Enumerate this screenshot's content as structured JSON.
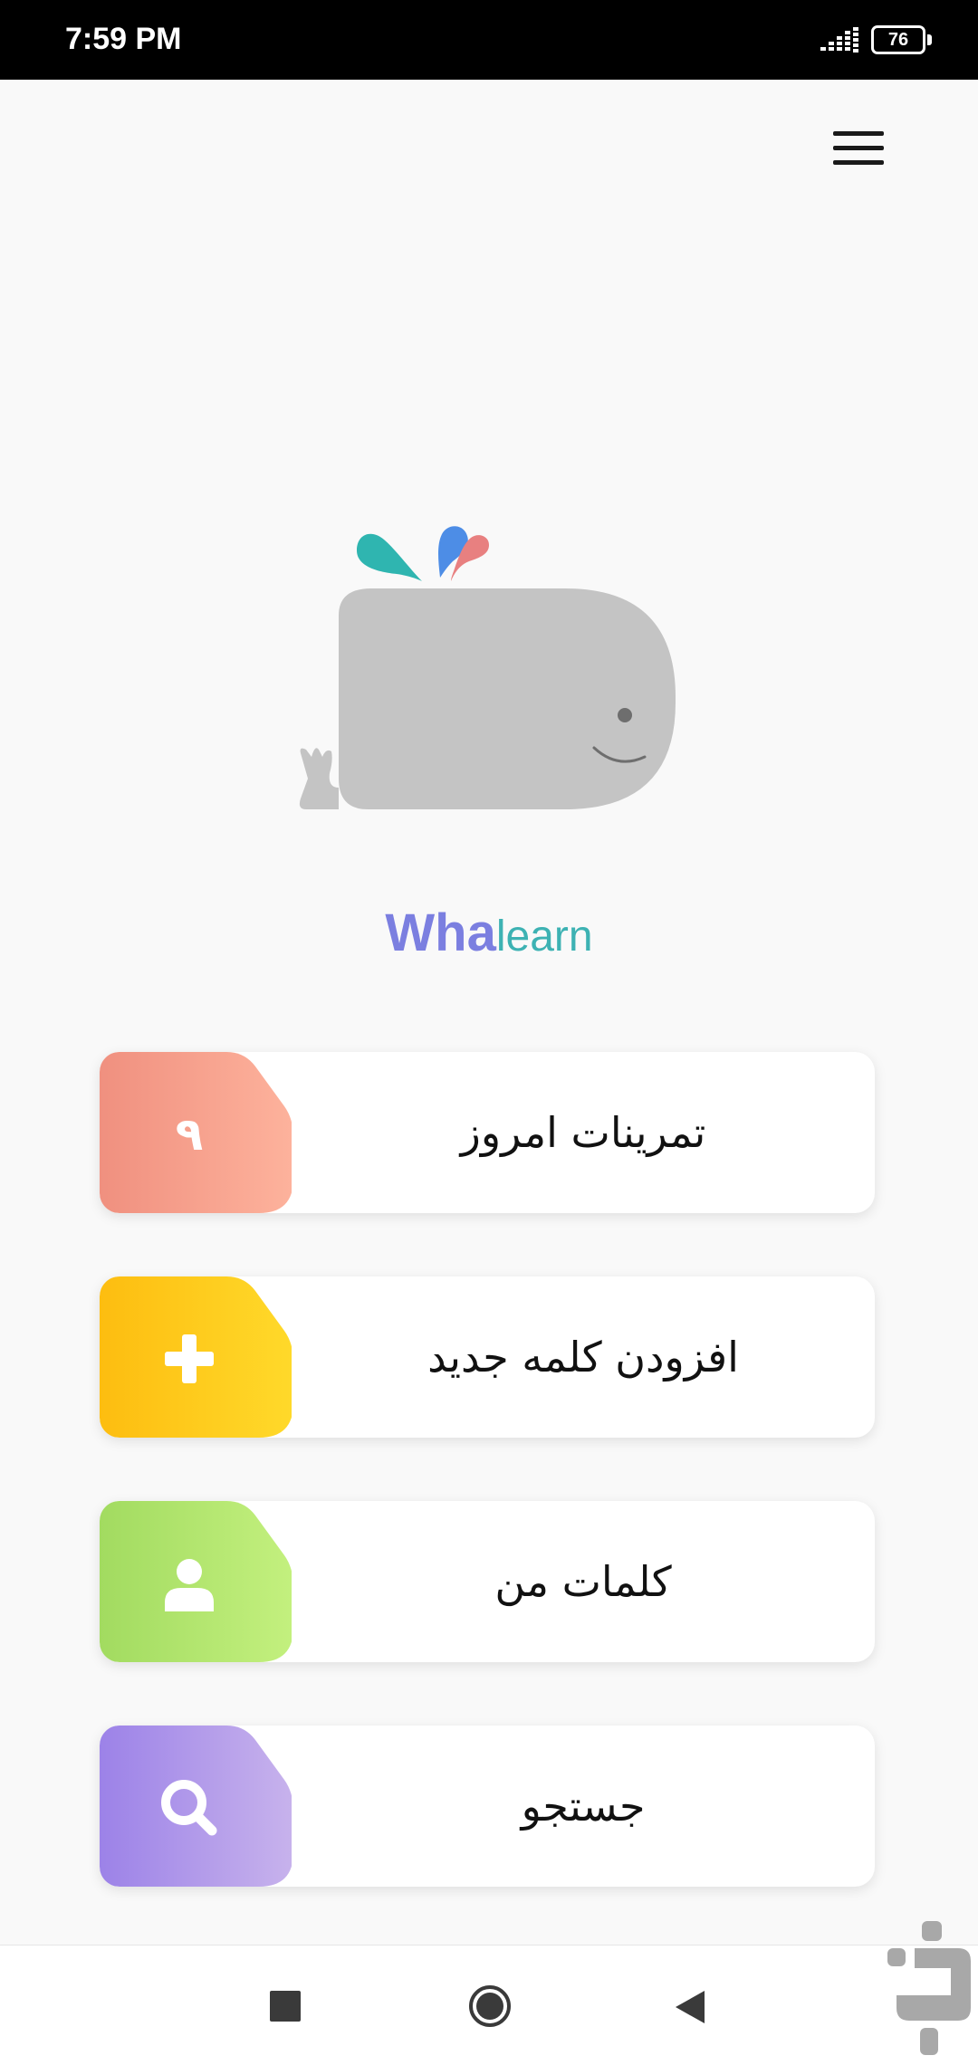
{
  "status_bar": {
    "time": "7:59 PM",
    "battery": "76",
    "icons": [
      "signal-icon",
      "battery-icon"
    ]
  },
  "header": {
    "menu_icon": "hamburger-menu-icon"
  },
  "brand": {
    "part_a": "Wha",
    "part_b": "learn",
    "colors": {
      "part_a": "#7b7fe0",
      "part_b": "#3db2b3",
      "whale_body": "#c4c4c4",
      "drop_teal": "#2fb5b0",
      "drop_blue": "#4d8de6",
      "drop_pink": "#e88080"
    }
  },
  "menu": {
    "items": [
      {
        "label": "تمرینات امروز",
        "badge": "۹",
        "icon": "count-badge",
        "color": "#f0907f"
      },
      {
        "label": "افزودن کلمه جدید",
        "badge": "+",
        "icon": "plus-icon",
        "color": "#fdbd10"
      },
      {
        "label": "کلمات من",
        "badge": "",
        "icon": "user-icon",
        "color": "#a2db60"
      },
      {
        "label": "جستجو",
        "badge": "",
        "icon": "search-icon",
        "color": "#9c82e8"
      }
    ]
  },
  "nav_bar": {
    "icons": [
      "recents-icon",
      "home-icon",
      "back-icon"
    ]
  }
}
